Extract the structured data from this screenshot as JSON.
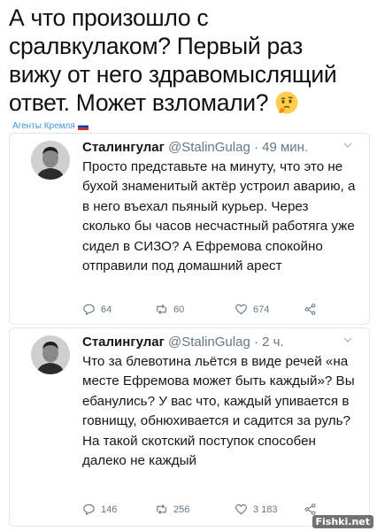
{
  "headline": {
    "line1": "А что произошло с",
    "line2": "сралвкулаком? Первый раз",
    "line3": "вижу от него здравомыслящий",
    "line4": "ответ. Может взломали?"
  },
  "source": {
    "label": "Агенты Кремля",
    "color": "#3b94d9",
    "icon": "russian-flag-icon"
  },
  "tweets": [
    {
      "name": "Сталингулаг",
      "handle": "@StalinGulag · 49 мин.",
      "text": "Просто представьте на минуту, что это не бухой знаменитый актёр устроил аварию, а в него въехал пьяный курьер. Через сколько бы часов несчастный работяга уже сидел в СИЗО? А Ефремова спокойно отправили под домашний арест",
      "replies": "64",
      "retweets": "60",
      "likes": "674"
    },
    {
      "name": "Сталингулаг",
      "handle": "@StalinGulag · 2 ч.",
      "text": "Что за блевотина льётся в виде речей «на месте Ефремова может быть каждый»? Вы ебанулись? У вас что, каждый упивается в говнищу, обнюхивается и садится за руль? На такой скотский поступок способен далеко не каждый",
      "replies": "146",
      "retweets": "256",
      "likes": "3 183"
    }
  ],
  "watermark": "Fishki.net",
  "colors": {
    "text": "#14171a",
    "muted": "#657786",
    "link": "#3b94d9",
    "border": "#e1e8ed"
  }
}
